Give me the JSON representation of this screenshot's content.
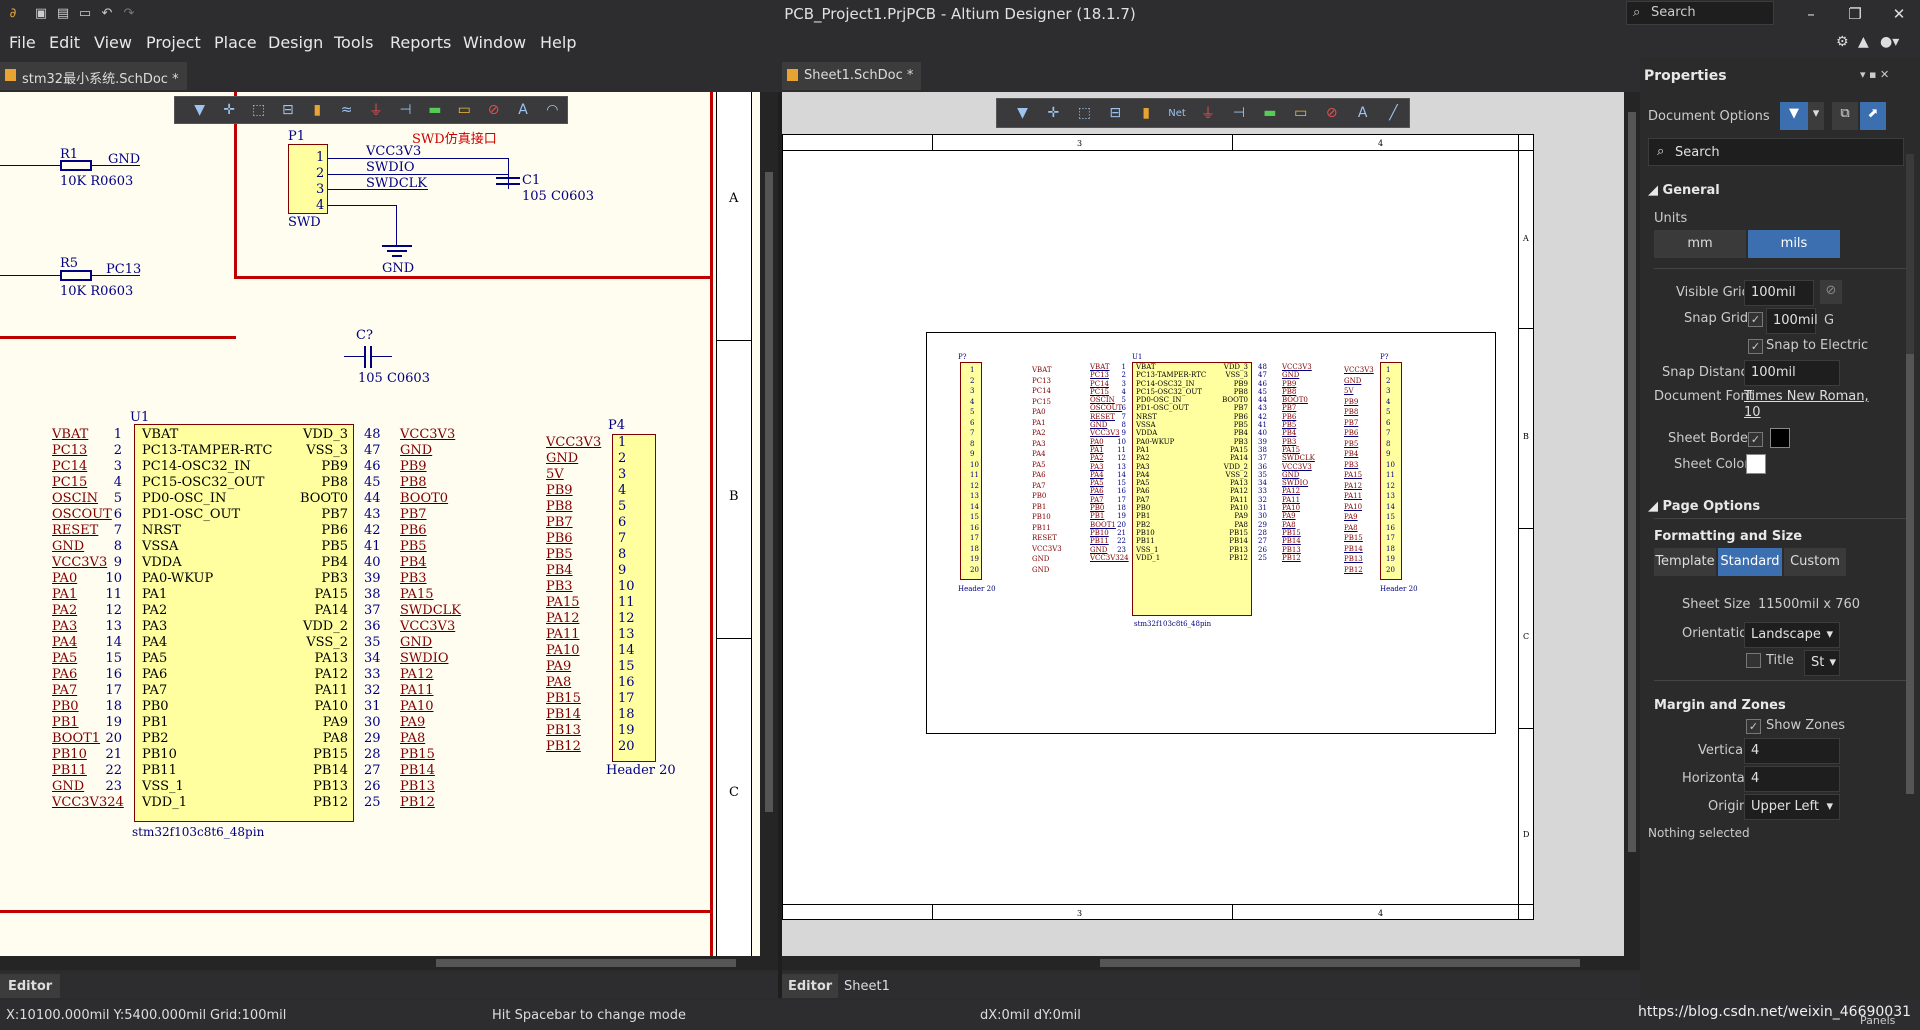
{
  "window": {
    "title": "PCB_Project1.PrjPCB - Altium Designer (18.1.7)",
    "search": "Search"
  },
  "menu": [
    "File",
    "Edit",
    "View",
    "Project",
    "Place",
    "Design",
    "Tools",
    "Reports",
    "Window",
    "Help"
  ],
  "tabs": {
    "left": "stm32最小系统.SchDoc *",
    "right": "Sheet1.SchDoc *"
  },
  "left": {
    "swd_title": "SWD仿真接口",
    "r1": {
      "name": "R1",
      "val": "10K R0603",
      "net": "GND"
    },
    "r5": {
      "name": "R5",
      "val": "10K R0603",
      "net": "PC13"
    },
    "p1": {
      "name": "P1",
      "foot": "SWD",
      "pins": [
        "1",
        "2",
        "3",
        "4"
      ],
      "nets": [
        "VCC3V3",
        "SWDIO",
        "SWDCLK"
      ],
      "gnd": "GND"
    },
    "c1": {
      "name": "C1",
      "val": "105 C0603"
    },
    "c7": {
      "name": "C?",
      "val": "105 C0603"
    },
    "u1": {
      "name": "U1",
      "part": "stm32f103c8t6_48pin",
      "lnets": [
        "VBAT",
        "PC13",
        "PC14",
        "PC15",
        "OSCIN",
        "OSCOUT",
        "RESET",
        "GND",
        "VCC3V3",
        "PA0",
        "PA1",
        "PA2",
        "PA3",
        "PA4",
        "PA5",
        "PA6",
        "PA7",
        "PB0",
        "PB1",
        "BOOT1",
        "PB10",
        "PB11",
        "GND",
        "VCC3V324"
      ],
      "lnums": [
        "1",
        "2",
        "3",
        "4",
        "5",
        "6",
        "7",
        "8",
        "9",
        "10",
        "11",
        "12",
        "13",
        "14",
        "15",
        "16",
        "17",
        "18",
        "19",
        "20",
        "21",
        "22",
        "23",
        ""
      ],
      "lpins": [
        "VBAT",
        "PC13-TAMPER-RTC",
        "PC14-OSC32_IN",
        "PC15-OSC32_OUT",
        "PD0-OSC_IN",
        "PD1-OSC_OUT",
        "NRST",
        "VSSA",
        "VDDA",
        "PA0-WKUP",
        "PA1",
        "PA2",
        "PA3",
        "PA4",
        "PA5",
        "PA6",
        "PA7",
        "PB0",
        "PB1",
        "PB2",
        "PB10",
        "PB11",
        "VSS_1",
        "VDD_1"
      ],
      "rpins": [
        "VDD_3",
        "VSS_3",
        "PB9",
        "PB8",
        "BOOT0",
        "PB7",
        "PB6",
        "PB5",
        "PB4",
        "PB3",
        "PA15",
        "PA14",
        "VDD_2",
        "VSS_2",
        "PA13",
        "PA12",
        "PA11",
        "PA10",
        "PA9",
        "PA8",
        "PB15",
        "PB14",
        "PB13",
        "PB12"
      ],
      "rnums": [
        "48",
        "47",
        "46",
        "45",
        "44",
        "43",
        "42",
        "41",
        "40",
        "39",
        "38",
        "37",
        "36",
        "35",
        "34",
        "33",
        "32",
        "31",
        "30",
        "29",
        "28",
        "27",
        "26",
        "25"
      ],
      "rnets": [
        "VCC3V3",
        "GND",
        "PB9",
        "PB8",
        "BOOT0",
        "PB7",
        "PB6",
        "PB5",
        "PB4",
        "PB3",
        "PA15",
        "SWDCLK",
        "VCC3V3",
        "GND",
        "SWDIO",
        "PA12",
        "PA11",
        "PA10",
        "PA9",
        "PA8",
        "PB15",
        "PB14",
        "PB13",
        "PB12"
      ]
    },
    "p4": {
      "name": "P4",
      "foot": "Header 20",
      "nets": [
        "VCC3V3",
        "GND",
        "5V",
        "PB9",
        "PB8",
        "PB7",
        "PB6",
        "PB5",
        "PB4",
        "PB3",
        "PA15",
        "PA12",
        "PA11",
        "PA10",
        "PA9",
        "PA8",
        "PB15",
        "PB14",
        "PB13",
        "PB12"
      ],
      "pins": [
        "1",
        "2",
        "3",
        "4",
        "5",
        "6",
        "7",
        "8",
        "9",
        "10",
        "11",
        "12",
        "13",
        "14",
        "15",
        "16",
        "17",
        "18",
        "19",
        "20"
      ]
    },
    "zones": [
      "A",
      "B",
      "C"
    ]
  },
  "right": {
    "top_zones": [
      "3",
      "4"
    ],
    "side_zones": [
      "A",
      "B",
      "C",
      "D"
    ],
    "lh": {
      "name": "P?",
      "foot": "Header 20",
      "nets": [
        "VBAT",
        "PC13",
        "PC14",
        "PC15",
        "PA0",
        "PA1",
        "PA2",
        "PA3",
        "PA4",
        "PA5",
        "PA6",
        "PA7",
        "PB0",
        "PB1",
        "PB10",
        "PB11",
        "RESET",
        "VCC3V3",
        "GND",
        "GND"
      ]
    },
    "rh": {
      "name": "P?",
      "foot": "Header 20",
      "nets": [
        "VCC3V3",
        "GND",
        "5V",
        "PB9",
        "PB8",
        "PB7",
        "PB6",
        "PB5",
        "PB4",
        "PB3",
        "PA15",
        "PA12",
        "PA11",
        "PA10",
        "PA9",
        "PA8",
        "PB15",
        "PB14",
        "PB13",
        "PB12"
      ]
    },
    "pins20": [
      "1",
      "2",
      "3",
      "4",
      "5",
      "6",
      "7",
      "8",
      "9",
      "10",
      "11",
      "12",
      "13",
      "14",
      "15",
      "16",
      "17",
      "18",
      "19",
      "20"
    ],
    "u1": {
      "name": "U1",
      "part": "stm32f103c8t6_48pin"
    }
  },
  "panel": {
    "title": "Properties",
    "doc_options": "Document Options",
    "search": "Search",
    "general": "General",
    "units": "Units",
    "mm": "mm",
    "mils": "mils",
    "visible_grid": "Visible Grid",
    "visible_grid_val": "100mil",
    "snap_grid": "Snap Grid",
    "snap_grid_val": "100mil",
    "snap_grid_key": "G",
    "snap_electric": "Snap to Electric",
    "snap_distance": "Snap Distance",
    "snap_distance_val": "100mil",
    "doc_font": "Document Font",
    "doc_font_val": "Times New Roman,",
    "doc_font_size": "10",
    "sheet_border": "Sheet Border",
    "sheet_color": "Sheet Color",
    "page_options": "Page Options",
    "formatting": "Formatting and Size",
    "template": "Template",
    "standard": "Standard",
    "custom": "Custom",
    "sheet_size": "Sheet Size",
    "sheet_size_val": "11500mil x 760",
    "orientation": "Orientation",
    "orientation_val": "Landscape",
    "title_lbl": "Title",
    "title_val": "St",
    "margin": "Margin and Zones",
    "show_zones": "Show Zones",
    "vertical": "Vertical",
    "vertical_val": "4",
    "horizontal": "Horizontal",
    "horizontal_val": "4",
    "origin": "Origin",
    "origin_val": "Upper Left",
    "nothing": "Nothing selected"
  },
  "editor": {
    "left": "Editor",
    "right": "Editor",
    "sheet1": "Sheet1"
  },
  "status": {
    "coords": "X:10100.000mil Y:5400.000mil",
    "grid": "Grid:100mil",
    "hint": "Hit Spacebar to change mode",
    "delta": "dX:0mil dY:0mil",
    "url": "https://blog.csdn.net/weixin_46690031",
    "panels": "Panels"
  }
}
